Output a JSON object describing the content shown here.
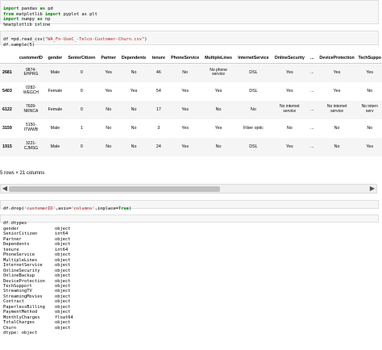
{
  "cell1": {
    "lines": [
      {
        "kw1": "import",
        "mod": "pandas",
        "kw2": "as",
        "alias": "pd"
      },
      {
        "kw1": "from",
        "mod": "matplotlib",
        "kw2": "import",
        "alias": "pyplot as plt"
      },
      {
        "kw1": "import",
        "mod": "numpy",
        "kw2": "as",
        "alias": "np"
      },
      {
        "kw1": "",
        "mod": "%matplotlib inline",
        "kw2": "",
        "alias": ""
      }
    ]
  },
  "cell2": {
    "line1_prefix": "df =pd.read_csv(",
    "line1_string": "\"WA_Fn-UseC_-Telco-Customer-Churn.csv\"",
    "line1_suffix": ")",
    "line2": "df.sample(5)"
  },
  "dataframe": {
    "columns": [
      "",
      "customerID",
      "gender",
      "SeniorCitizen",
      "Partner",
      "Dependents",
      "tenure",
      "PhoneService",
      "MultipleLines",
      "InternetService",
      "OnlineSecurity",
      "...",
      "DeviceProtection",
      "TechSuppo"
    ],
    "rows": [
      [
        "2681",
        "9874-\nEHPRG",
        "Male",
        "0",
        "Yes",
        "No",
        "46",
        "No",
        "No phone\nservice",
        "DSL",
        "Yes",
        "...",
        "Yes",
        "Yes"
      ],
      [
        "5403",
        "0282-\nWEGCH",
        "Female",
        "0",
        "Yes",
        "Yes",
        "54",
        "Yes",
        "Yes",
        "DSL",
        "Yes",
        "...",
        "Yes",
        "No"
      ],
      [
        "6122",
        "7609-\nNRNCA",
        "Female",
        "0",
        "No",
        "No",
        "17",
        "Yes",
        "No",
        "No",
        "No internet\nservice",
        "...",
        "No internet\nservice",
        "No intern\nserv"
      ],
      [
        "3159",
        "5150-\nITWWB",
        "Male",
        "1",
        "No",
        "No",
        "3",
        "Yes",
        "Yes",
        "Fiber optic",
        "No",
        "...",
        "No",
        "No"
      ],
      [
        "1915",
        "3221-\nCJMSG",
        "Male",
        "0",
        "No",
        "No",
        "24",
        "Yes",
        "No",
        "DSL",
        "Yes",
        "...",
        "No",
        "Yes"
      ]
    ]
  },
  "rows_note": "5 rows × 21 columns",
  "cell3": {
    "prefix": "df.drop(",
    "arg1": "'customerID'",
    "sep1": ",axis=",
    "arg2": "'columns'",
    "sep2": ",inplace=",
    "arg3": "True",
    "suffix": ")"
  },
  "cell4": {
    "code": "df.dtypes"
  },
  "dtypes": [
    [
      "gender",
      "object"
    ],
    [
      "SeniorCitizen",
      "int64"
    ],
    [
      "Partner",
      "object"
    ],
    [
      "Dependents",
      "object"
    ],
    [
      "tenure",
      "int64"
    ],
    [
      "PhoneService",
      "object"
    ],
    [
      "MultipleLines",
      "object"
    ],
    [
      "InternetService",
      "object"
    ],
    [
      "OnlineSecurity",
      "object"
    ],
    [
      "OnlineBackup",
      "object"
    ],
    [
      "DeviceProtection",
      "object"
    ],
    [
      "TechSupport",
      "object"
    ],
    [
      "StreamingTV",
      "object"
    ],
    [
      "StreamingMovies",
      "object"
    ],
    [
      "Contract",
      "object"
    ],
    [
      "PaperlessBilling",
      "object"
    ],
    [
      "PaymentMethod",
      "object"
    ],
    [
      "MonthlyCharges",
      "float64"
    ],
    [
      "TotalCharges",
      "object"
    ],
    [
      "Churn",
      "object"
    ]
  ],
  "dtype_footer": "dtype: object",
  "scroll_left_icon": "chevron-left-icon",
  "scroll_right_icon": "chevron-right-icon"
}
